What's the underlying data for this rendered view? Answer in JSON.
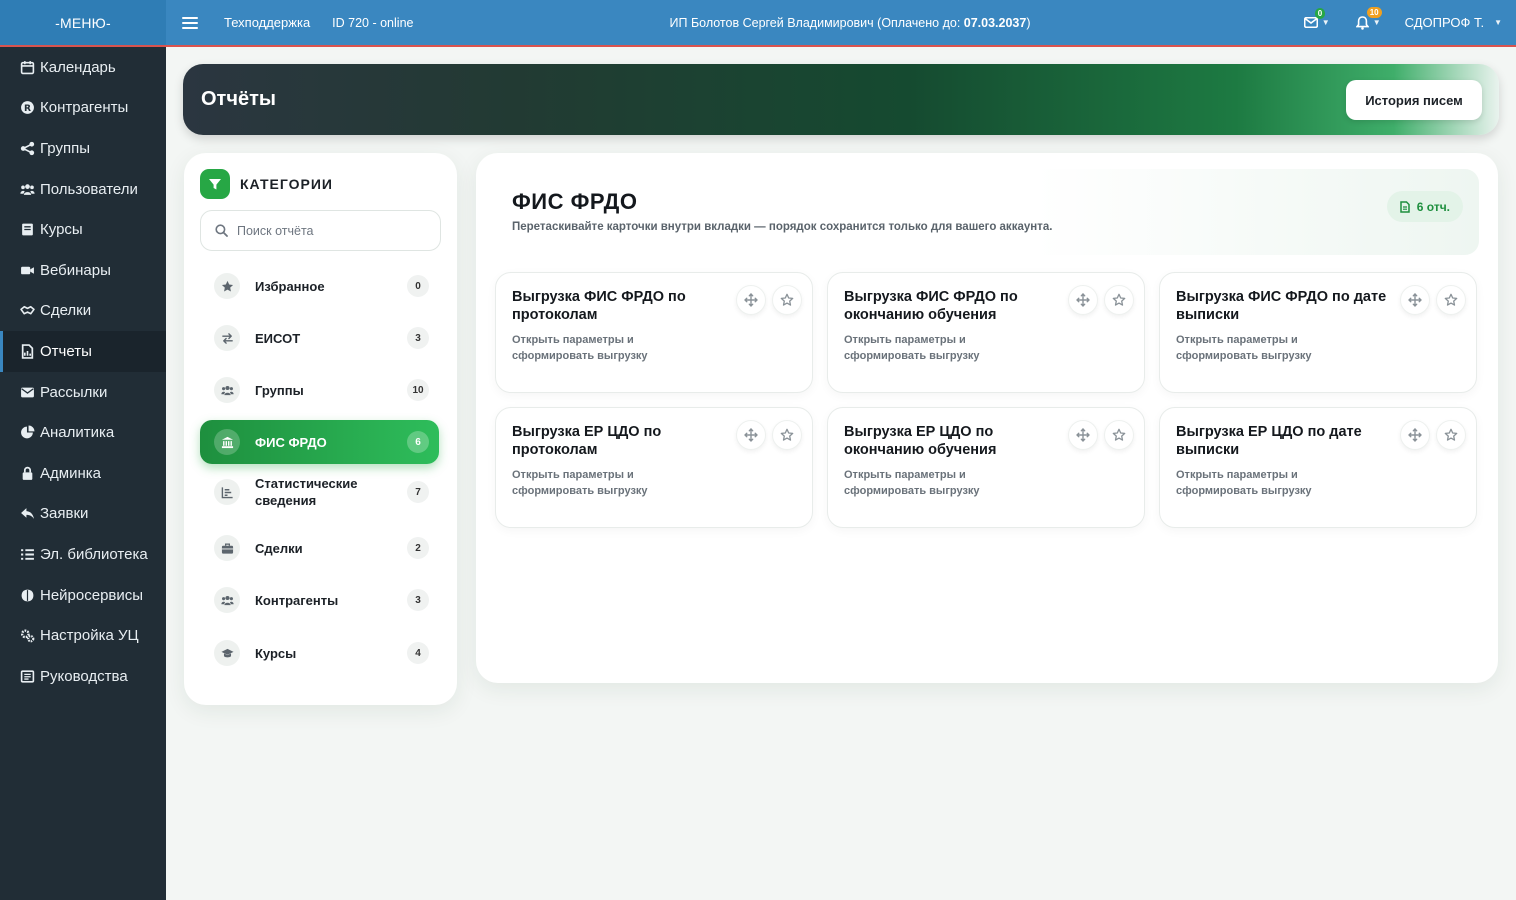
{
  "topbar": {
    "menu_label": "-МЕНЮ-",
    "support_label": "Техподдержка",
    "id_status": "ID 720 - online",
    "owner_text": "ИП Болотов Сергей Владимирович (Оплачено до: ",
    "paid_until": "07.03.2037",
    "owner_close": ")",
    "mail_badge": "0",
    "bell_badge": "10",
    "user_name": "СДОПРОФ Т."
  },
  "sidebar": {
    "items": [
      {
        "label": "Календарь",
        "icon": "calendar-icon"
      },
      {
        "label": "Контрагенты",
        "icon": "registered-icon"
      },
      {
        "label": "Группы",
        "icon": "share-icon"
      },
      {
        "label": "Пользователи",
        "icon": "users-icon"
      },
      {
        "label": "Курсы",
        "icon": "book-icon"
      },
      {
        "label": "Вебинары",
        "icon": "video-icon"
      },
      {
        "label": "Сделки",
        "icon": "handshake-icon"
      },
      {
        "label": "Отчеты",
        "icon": "report-icon"
      },
      {
        "label": "Рассылки",
        "icon": "envelope-icon"
      },
      {
        "label": "Аналитика",
        "icon": "pie-chart-icon"
      },
      {
        "label": "Админка",
        "icon": "lock-icon"
      },
      {
        "label": "Заявки",
        "icon": "reply-icon"
      },
      {
        "label": "Эл. библиотека",
        "icon": "list-icon"
      },
      {
        "label": "Нейросервисы",
        "icon": "brain-icon"
      },
      {
        "label": "Настройка УЦ",
        "icon": "gears-icon"
      },
      {
        "label": "Руководства",
        "icon": "manual-icon"
      }
    ],
    "active_index": 7
  },
  "banner": {
    "title": "Отчёты",
    "history_button": "История писем"
  },
  "categories": {
    "title": "КАТЕГОРИИ",
    "search_placeholder": "Поиск отчёта",
    "items": [
      {
        "label": "Избранное",
        "count": "0",
        "icon": "star-icon"
      },
      {
        "label": "ЕИСОТ",
        "count": "3",
        "icon": "exchange-icon"
      },
      {
        "label": "Группы",
        "count": "10",
        "icon": "users-icon"
      },
      {
        "label": "ФИС ФРДО",
        "count": "6",
        "icon": "bank-icon"
      },
      {
        "label": "Статистические сведения",
        "count": "7",
        "icon": "bar-chart-icon"
      },
      {
        "label": "Сделки",
        "count": "2",
        "icon": "briefcase-icon"
      },
      {
        "label": "Контрагенты",
        "count": "3",
        "icon": "users-icon"
      },
      {
        "label": "Курсы",
        "count": "4",
        "icon": "graduation-cap-icon"
      }
    ],
    "active_index": 3
  },
  "content": {
    "title": "ФИС ФРДО",
    "subtitle": "Перетаскивайте карточки внутри вкладки — порядок сохранится только для вашего аккаунта.",
    "count_badge": "6 отч.",
    "cards": [
      {
        "title": "Выгрузка ФИС ФРДО по протоколам",
        "desc": "Открыть параметры и сформировать выгрузку"
      },
      {
        "title": "Выгрузка ФИС ФРДО по окончанию обучения",
        "desc": "Открыть параметры и сформировать выгрузку"
      },
      {
        "title": "Выгрузка ФИС ФРДО по дате выписки",
        "desc": "Открыть параметры и сформировать выгрузку"
      },
      {
        "title": "Выгрузка ЕР ЦДО по протоколам",
        "desc": "Открыть параметры и сформировать выгрузку"
      },
      {
        "title": "Выгрузка ЕР ЦДО по окончанию обучения",
        "desc": "Открыть параметры и сформировать выгрузку"
      },
      {
        "title": "Выгрузка ЕР ЦДО по дате выписки",
        "desc": "Открыть параметры и сформировать выгрузку"
      }
    ]
  },
  "colors": {
    "topbar": "#3a87c0",
    "sidebar": "#212d36",
    "accent_green": "#27a745"
  }
}
